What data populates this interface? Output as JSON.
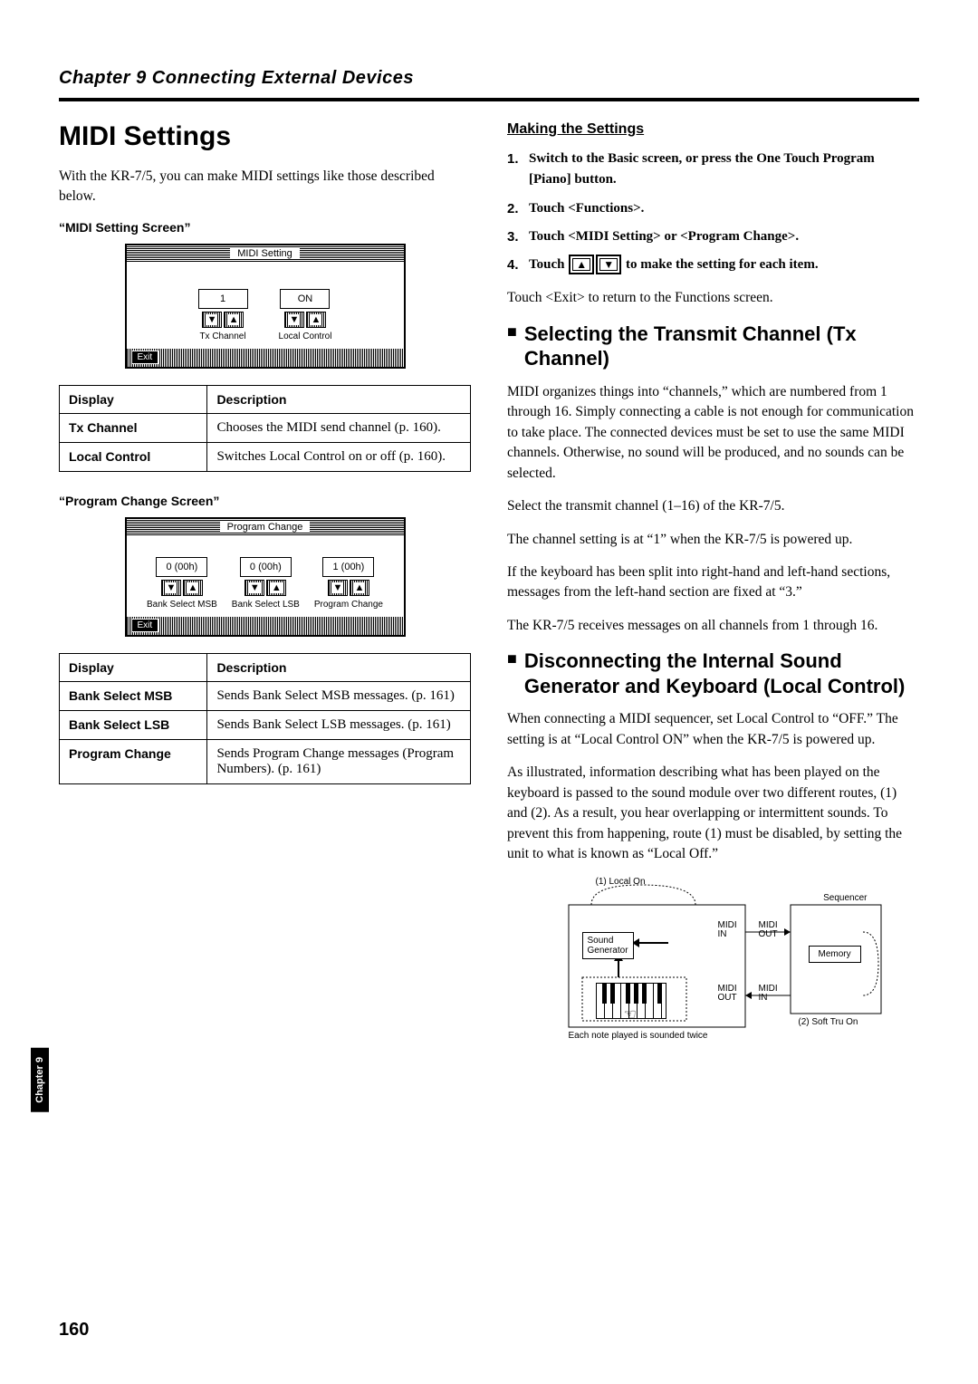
{
  "header": {
    "chapter": "Chapter 9  Connecting External Devices"
  },
  "left": {
    "title": "MIDI Settings",
    "intro": "With the KR-7/5, you can make MIDI settings like those described below.",
    "label1": "“MIDI Setting Screen”",
    "screen1": {
      "title": "MIDI Setting",
      "p1": {
        "value": "1",
        "label": "Tx Channel"
      },
      "p2": {
        "value": "ON",
        "label": "Local Control"
      },
      "exit": "Exit"
    },
    "table1": {
      "h1": "Display",
      "h2": "Description",
      "rows": [
        {
          "c1": "Tx Channel",
          "c2": "Chooses the MIDI send channel (p. 160)."
        },
        {
          "c1": "Local Control",
          "c2": "Switches Local Control on or off (p. 160)."
        }
      ]
    },
    "label2": "“Program Change Screen”",
    "screen2": {
      "title": "Program Change",
      "p1": {
        "value": "0 (00h)",
        "label": "Bank Select MSB"
      },
      "p2": {
        "value": "0 (00h)",
        "label": "Bank Select LSB"
      },
      "p3": {
        "value": "1 (00h)",
        "label": "Program Change"
      },
      "exit": "Exit"
    },
    "table2": {
      "h1": "Display",
      "h2": "Description",
      "rows": [
        {
          "c1": "Bank Select MSB",
          "c2": "Sends Bank Select MSB messages. (p. 161)"
        },
        {
          "c1": "Bank Select LSB",
          "c2": "Sends Bank Select LSB messages. (p. 161)"
        },
        {
          "c1": "Program Change",
          "c2": "Sends Program Change messages (Program Numbers). (p. 161)"
        }
      ]
    }
  },
  "right": {
    "subheading": "Making the Settings",
    "steps": {
      "s1": "Switch to the Basic screen, or press the One Touch Program [Piano] button.",
      "s2": "Touch <Functions>.",
      "s3": "Touch <MIDI Setting> or <Program Change>.",
      "s4a": "Touch ",
      "s4b": " to make the setting for each item."
    },
    "after_steps": "Touch <Exit> to return to the Functions screen.",
    "h2a": "Selecting the Transmit Channel (Tx Channel)",
    "paraA1": "MIDI organizes things into “channels,” which are numbered from 1 through 16. Simply connecting a cable is not enough for communication to take place. The connected devices must be set to use the same MIDI channels. Otherwise, no sound will be produced, and no sounds can be selected.",
    "paraA2": "Select the transmit channel (1–16) of the KR-7/5.",
    "paraA3": "The channel setting is at “1” when the KR-7/5 is powered up.",
    "paraA4": "If the keyboard has been split into right-hand and left-hand sections, messages from the left-hand section are fixed at “3.”",
    "paraA5": "The KR-7/5 receives messages on all channels from 1 through 16.",
    "h2b": "Disconnecting the Internal Sound Generator and Keyboard (Local Control)",
    "paraB1": "When connecting a MIDI sequencer, set Local Control to “OFF.” The setting is at “Local Control ON” when the KR-7/5 is powered up.",
    "paraB2": "As illustrated, information describing what has been played on the keyboard is passed to the sound module over two different routes, (1) and (2). As a result, you hear overlapping or intermittent sounds. To prevent this from happening, route (1) must be disabled, by setting the unit to what is known as “Local Off.”",
    "diagram": {
      "l_local": "(1)  Local On",
      "l_seq": "Sequencer",
      "l_sg": "Sound Generator",
      "l_mem": "Memory",
      "l_min": "MIDI IN",
      "l_mout": "MIDI OUT",
      "l_soft": "(2)  Soft Tru On",
      "caption": "Each note played is sounded twice"
    }
  },
  "sideTab": "Chapter 9",
  "pageNum": "160"
}
